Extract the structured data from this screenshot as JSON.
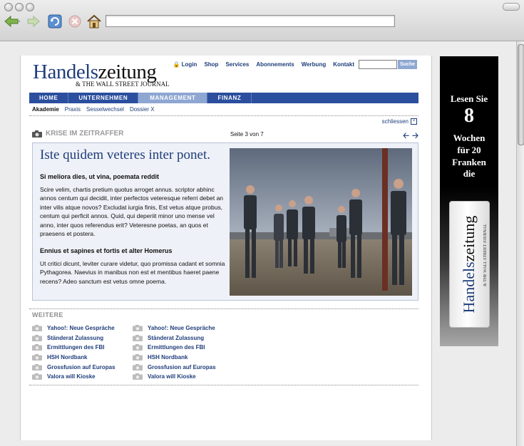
{
  "browser": {
    "url": ""
  },
  "header": {
    "logo_part1": "Handels",
    "logo_part2": "zeitung",
    "logo_sub": "& THE WALL STREET JOURNAL",
    "top_links": [
      "Login",
      "Shop",
      "Services",
      "Abonnements",
      "Werbung",
      "Kontakt"
    ],
    "search_value": "",
    "search_button": "Suche"
  },
  "main_nav": {
    "tabs": [
      {
        "label": "HOME",
        "active": false
      },
      {
        "label": "UNTERNEHMEN",
        "active": false
      },
      {
        "label": "MANAGEMENT",
        "active": true
      },
      {
        "label": "FINANZ",
        "active": false
      }
    ]
  },
  "sub_nav": {
    "items": [
      "Akademie",
      "Praxis",
      "Sesselwechsel",
      "Dossier X"
    ]
  },
  "gallery": {
    "close_label": "schliessen",
    "section_title": "KRISE IM ZEITRAFFER",
    "pager": "Seite 3 von 7",
    "headline": "Iste quidem veteres inter ponet.",
    "subhead1": "Si meliora dies, ut vina, poemata reddit",
    "para1": "Scire velim, chartis pretium quotus arroget annus. scriptor abhinc annos centum qui decidit, inter perfectos veteresque referri debet an inter vilis atque novos? Excludat iurgia finis, Est vetus atque probus, centum qui perficit annos. Quid, qui deperiit minor uno mense vel anno, inter quos referendus erit? Veteresne poetas, an quos et praesens et postera.",
    "subhead2": "Ennius et sapines et fortis et alter Homerus",
    "para2": "Ut critici dicunt, leviter curare videtur, quo promissa cadant et somnia Pythagorea. Naevius in manibus non est et mentibus haeret paene recens? Adeo sanctum est vetus omne poema."
  },
  "weitere": {
    "label": "WEITERE",
    "col1": [
      "Yahoo!: Neue Gespräche",
      "Ständerat Zulassung",
      "Ermittlungen des FBI",
      "HSH Nordbank",
      "Grossfusion auf Europas",
      "Valora will Kioske"
    ],
    "col2": [
      "Yahoo!: Neue Gespräche",
      "Ständerat Zulassung",
      "Ermittlungen des FBI",
      "HSH Nordbank",
      "Grossfusion auf Europas",
      "Valora will Kioske"
    ]
  },
  "ad": {
    "line1": "Lesen Sie",
    "number": "8",
    "line2": "Wochen",
    "line3": "für 20",
    "line4": "Franken",
    "line5": "die",
    "paper_part1": "Handels",
    "paper_part2": "zeitung",
    "paper_sub": "& THE WALL STREET JOURNAL"
  }
}
